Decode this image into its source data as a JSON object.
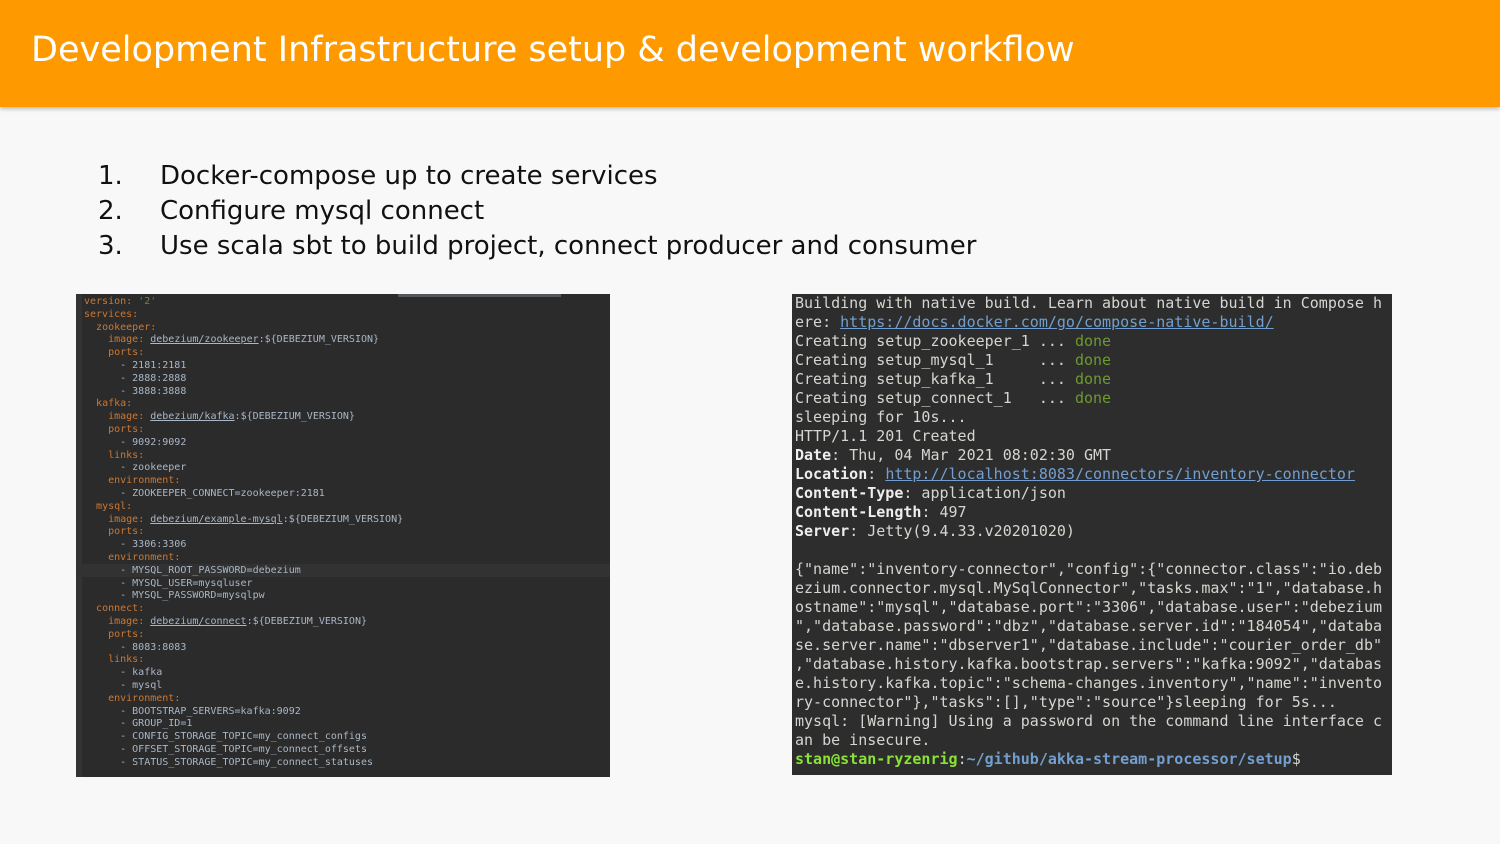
{
  "header": {
    "title": "Development Infrastructure setup & development workflow"
  },
  "steps": [
    {
      "num": "1.",
      "text": "Docker-compose up to create services"
    },
    {
      "num": "2.",
      "text": "Configure mysql connect"
    },
    {
      "num": "3.",
      "text": "Use scala sbt to build project, connect producer and consumer"
    }
  ],
  "yaml": {
    "lines": [
      {
        "indent": "",
        "key": "version",
        "sep": ": ",
        "val": "'2'",
        "valType": "str"
      },
      {
        "indent": "",
        "key": "services",
        "sep": ":",
        "val": "",
        "valType": ""
      },
      {
        "indent": "  ",
        "key": "zookeeper",
        "sep": ":",
        "val": "",
        "valType": ""
      },
      {
        "indent": "    ",
        "key": "image",
        "sep": ": ",
        "link": "debezium/zookeeper",
        "val": ":${DEBEZIUM_VERSION}",
        "valType": "plain"
      },
      {
        "indent": "    ",
        "key": "ports",
        "sep": ":",
        "val": "",
        "valType": ""
      },
      {
        "indent": "      ",
        "key": "",
        "sep": "",
        "val": "- 2181:2181",
        "valType": "plain"
      },
      {
        "indent": "      ",
        "key": "",
        "sep": "",
        "val": "- 2888:2888",
        "valType": "plain"
      },
      {
        "indent": "      ",
        "key": "",
        "sep": "",
        "val": "- 3888:3888",
        "valType": "plain"
      },
      {
        "indent": "  ",
        "key": "kafka",
        "sep": ":",
        "val": "",
        "valType": ""
      },
      {
        "indent": "    ",
        "key": "image",
        "sep": ": ",
        "link": "debezium/kafka",
        "val": ":${DEBEZIUM_VERSION}",
        "valType": "plain"
      },
      {
        "indent": "    ",
        "key": "ports",
        "sep": ":",
        "val": "",
        "valType": ""
      },
      {
        "indent": "      ",
        "key": "",
        "sep": "",
        "val": "- 9092:9092",
        "valType": "plain"
      },
      {
        "indent": "    ",
        "key": "links",
        "sep": ":",
        "val": "",
        "valType": ""
      },
      {
        "indent": "      ",
        "key": "",
        "sep": "",
        "val": "- zookeeper",
        "valType": "plain"
      },
      {
        "indent": "    ",
        "key": "environment",
        "sep": ":",
        "val": "",
        "valType": ""
      },
      {
        "indent": "      ",
        "key": "",
        "sep": "",
        "val": "- ZOOKEEPER_CONNECT=zookeeper:2181",
        "valType": "plain"
      },
      {
        "indent": "  ",
        "key": "mysql",
        "sep": ":",
        "val": "",
        "valType": ""
      },
      {
        "indent": "    ",
        "key": "image",
        "sep": ": ",
        "link": "debezium/example-mysql",
        "val": ":${DEBEZIUM_VERSION}",
        "valType": "plain"
      },
      {
        "indent": "    ",
        "key": "ports",
        "sep": ":",
        "val": "",
        "valType": ""
      },
      {
        "indent": "      ",
        "key": "",
        "sep": "",
        "val": "- 3306:3306",
        "valType": "plain"
      },
      {
        "indent": "    ",
        "key": "environment",
        "sep": ":",
        "val": "",
        "valType": ""
      },
      {
        "indent": "      ",
        "key": "",
        "sep": "",
        "val": "- MYSQL_ROOT_PASSWORD=debezium",
        "valType": "plain"
      },
      {
        "indent": "      ",
        "key": "",
        "sep": "",
        "val": "- MYSQL_USER=mysqluser",
        "valType": "plain"
      },
      {
        "indent": "      ",
        "key": "",
        "sep": "",
        "val": "- MYSQL_PASSWORD=mysqlpw",
        "valType": "plain"
      },
      {
        "indent": "  ",
        "key": "connect",
        "sep": ":",
        "val": "",
        "valType": ""
      },
      {
        "indent": "    ",
        "key": "image",
        "sep": ": ",
        "link": "debezium/connect",
        "val": ":${DEBEZIUM_VERSION}",
        "valType": "plain"
      },
      {
        "indent": "    ",
        "key": "ports",
        "sep": ":",
        "val": "",
        "valType": ""
      },
      {
        "indent": "      ",
        "key": "",
        "sep": "",
        "val": "- 8083:8083",
        "valType": "plain"
      },
      {
        "indent": "    ",
        "key": "links",
        "sep": ":",
        "val": "",
        "valType": ""
      },
      {
        "indent": "      ",
        "key": "",
        "sep": "",
        "val": "- kafka",
        "valType": "plain"
      },
      {
        "indent": "      ",
        "key": "",
        "sep": "",
        "val": "- mysql",
        "valType": "plain"
      },
      {
        "indent": "    ",
        "key": "environment",
        "sep": ":",
        "val": "",
        "valType": ""
      },
      {
        "indent": "      ",
        "key": "",
        "sep": "",
        "val": "- BOOTSTRAP_SERVERS=kafka:9092",
        "valType": "plain"
      },
      {
        "indent": "      ",
        "key": "",
        "sep": "",
        "val": "- GROUP_ID=1",
        "valType": "plain"
      },
      {
        "indent": "      ",
        "key": "",
        "sep": "",
        "val": "- CONFIG_STORAGE_TOPIC=my_connect_configs",
        "valType": "plain"
      },
      {
        "indent": "      ",
        "key": "",
        "sep": "",
        "val": "- OFFSET_STORAGE_TOPIC=my_connect_offsets",
        "valType": "plain"
      },
      {
        "indent": "      ",
        "key": "",
        "sep": "",
        "val": "- STATUS_STORAGE_TOPIC=my_connect_statuses",
        "valType": "plain"
      }
    ]
  },
  "terminal": {
    "lines": [
      [
        {
          "t": "Building with native build. Learn about native build in Compose h",
          "s": ""
        }
      ],
      [
        {
          "t": "ere: ",
          "s": ""
        },
        {
          "t": "https://docs.docker.com/go/compose-native-build/",
          "s": "link"
        }
      ],
      [
        {
          "t": "Creating setup_zookeeper_1 ... ",
          "s": ""
        },
        {
          "t": "done",
          "s": "done"
        }
      ],
      [
        {
          "t": "Creating setup_mysql_1     ... ",
          "s": ""
        },
        {
          "t": "done",
          "s": "done"
        }
      ],
      [
        {
          "t": "Creating setup_kafka_1     ... ",
          "s": ""
        },
        {
          "t": "done",
          "s": "done"
        }
      ],
      [
        {
          "t": "Creating setup_connect_1   ... ",
          "s": ""
        },
        {
          "t": "done",
          "s": "done"
        }
      ],
      [
        {
          "t": "sleeping for 10s...",
          "s": ""
        }
      ],
      [
        {
          "t": "HTTP/1.1 201 Created",
          "s": ""
        }
      ],
      [
        {
          "t": "Date",
          "s": "bold"
        },
        {
          "t": ": Thu, 04 Mar 2021 08:02:30 GMT",
          "s": ""
        }
      ],
      [
        {
          "t": "Location",
          "s": "bold"
        },
        {
          "t": ": ",
          "s": ""
        },
        {
          "t": "http://localhost:8083/connectors/inventory-connector",
          "s": "link"
        }
      ],
      [
        {
          "t": "Content-Type",
          "s": "bold"
        },
        {
          "t": ": application/json",
          "s": ""
        }
      ],
      [
        {
          "t": "Content-Length",
          "s": "bold"
        },
        {
          "t": ": 497",
          "s": ""
        }
      ],
      [
        {
          "t": "Server",
          "s": "bold"
        },
        {
          "t": ": Jetty(9.4.33.v20201020)",
          "s": ""
        }
      ],
      [
        {
          "t": "",
          "s": ""
        }
      ],
      [
        {
          "t": "{\"name\":\"inventory-connector\",\"config\":{\"connector.class\":\"io.deb",
          "s": ""
        }
      ],
      [
        {
          "t": "ezium.connector.mysql.MySqlConnector\",\"tasks.max\":\"1\",\"database.h",
          "s": ""
        }
      ],
      [
        {
          "t": "ostname\":\"mysql\",\"database.port\":\"3306\",\"database.user\":\"debezium",
          "s": ""
        }
      ],
      [
        {
          "t": "\",\"database.password\":\"dbz\",\"database.server.id\":\"184054\",\"databa",
          "s": ""
        }
      ],
      [
        {
          "t": "se.server.name\":\"dbserver1\",\"database.include\":\"courier_order_db\"",
          "s": ""
        }
      ],
      [
        {
          "t": ",\"database.history.kafka.bootstrap.servers\":\"kafka:9092\",\"databas",
          "s": ""
        }
      ],
      [
        {
          "t": "e.history.kafka.topic\":\"schema-changes.inventory\",\"name\":\"invento",
          "s": ""
        }
      ],
      [
        {
          "t": "ry-connector\"},\"tasks\":[],\"type\":\"source\"}sleeping for 5s...",
          "s": ""
        }
      ],
      [
        {
          "t": "mysql: [Warning] Using a password on the command line interface c",
          "s": ""
        }
      ],
      [
        {
          "t": "an be insecure.",
          "s": ""
        }
      ],
      [
        {
          "t": "stan@stan-ryzenrig",
          "s": "user"
        },
        {
          "t": ":",
          "s": ""
        },
        {
          "t": "~/github/akka-stream-processor/setup",
          "s": "path"
        },
        {
          "t": "$",
          "s": ""
        }
      ]
    ]
  }
}
